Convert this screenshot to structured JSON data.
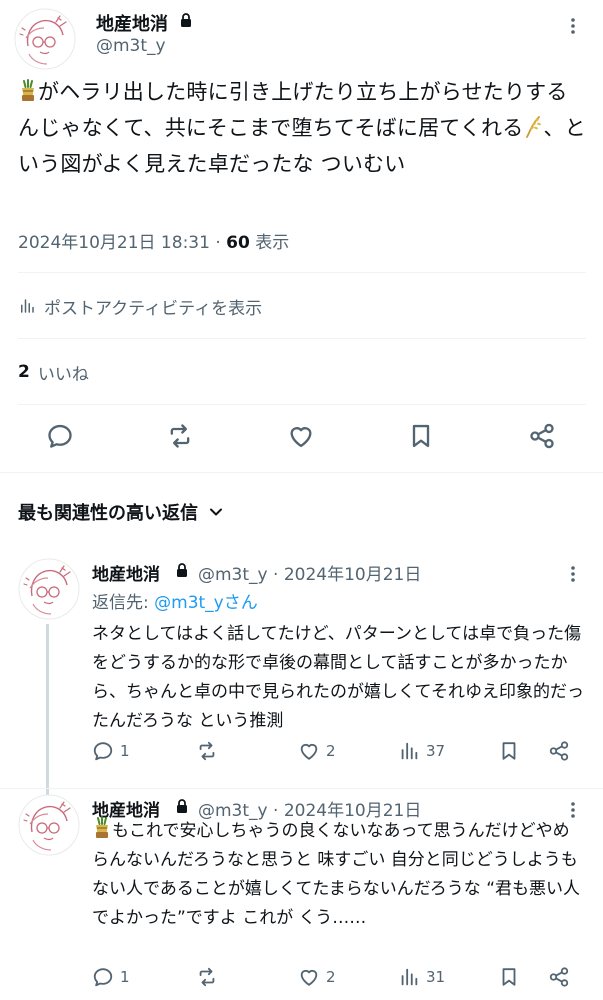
{
  "main_tweet": {
    "author_name": "地産地消",
    "handle": "@m3t_y",
    "text": "がヘラリ出した時に引き上げたり立ち上がらせたりするんじゃなくて、共にそこまで堕ちてそばに居てくれる",
    "text_tail": "、という図がよく見えた卓だったな ついむい",
    "timestamp": "2024年10月21日 18:31",
    "separator": "·",
    "views_count": "60",
    "views_label": "表示",
    "activity_label": "ポストアクティビティを表示",
    "likes_count": "2",
    "likes_label": "いいね",
    "icons": [
      "reply-icon",
      "repost-icon",
      "like-icon",
      "bookmark-icon",
      "share-icon"
    ]
  },
  "sort": {
    "label": "最も関連性の高い返信"
  },
  "replies": [
    {
      "author_name": "地産地消",
      "handle": "@m3t_y",
      "separator": "·",
      "date": "2024年10月21日",
      "reply_to_prefix": "返信先: ",
      "reply_to_handle": "@m3t_yさん",
      "text": "ネタとしてはよく話してたけど、パターンとしては卓で負った傷をどうするか的な形で卓後の幕間として話すことが多かったから、ちゃんと卓の中で見られたのが嬉しくてそれゆえ印象的だったんだろうな という推測",
      "reply_count": "1",
      "repost_count": "",
      "like_count": "2",
      "view_count": "37"
    },
    {
      "author_name": "地産地消",
      "handle": "@m3t_y",
      "separator": "·",
      "date": "2024年10月21日",
      "text": "もこれで安心しちゃうの良くないなあって思うんだけどやめらんないんだろうなと思うと 味すごい 自分と同じどうしようもない人であることが嬉しくてたまらないんだろうな “君も悪い人でよかった”ですよ これが くう……",
      "reply_count": "1",
      "repost_count": "",
      "like_count": "2",
      "view_count": "31"
    }
  ],
  "colors": {
    "text": "#0f1419",
    "muted": "#536471",
    "link": "#1d9bf0",
    "divider": "#eff3f4",
    "thread_line": "#cfd9de"
  }
}
